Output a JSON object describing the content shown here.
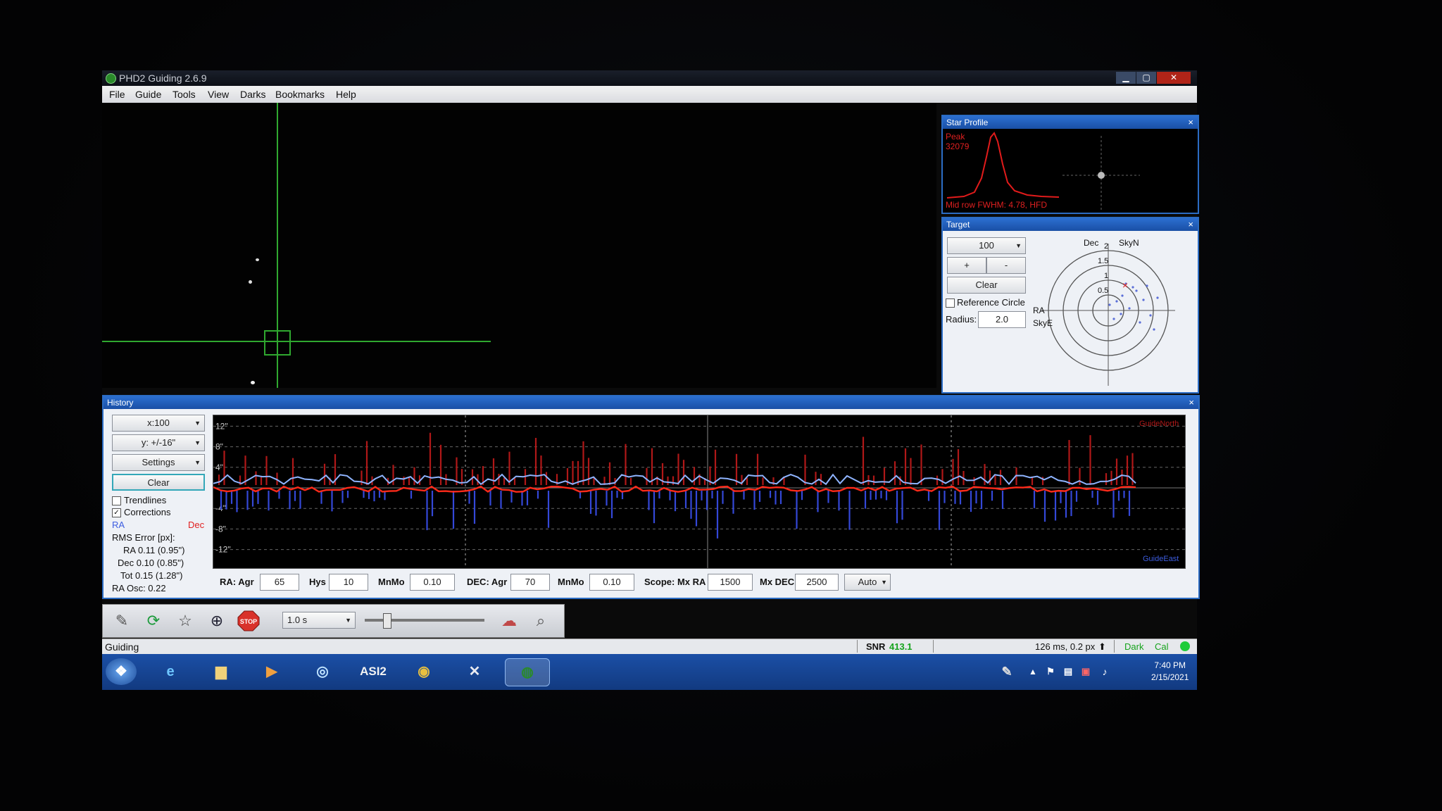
{
  "window": {
    "title": "PHD2 Guiding 2.6.9",
    "min_glyph": "▁",
    "max_glyph": "▢",
    "close_glyph": "✕"
  },
  "menu": [
    "File",
    "Guide",
    "Tools",
    "View",
    "Darks",
    "Bookmarks",
    "Help"
  ],
  "star_profile": {
    "title": "Star Profile",
    "close": "×",
    "peak_label": "Peak",
    "peak_value": "32079",
    "footer": "Mid row FWHM: 4.78, HFD"
  },
  "target": {
    "title": "Target",
    "close": "×",
    "zoom_value": "100",
    "plus": "+",
    "minus": "-",
    "clear": "Clear",
    "reference_circle": "Reference Circle",
    "radius_label": "Radius:",
    "radius_value": "2.0",
    "axis_dec": "Dec",
    "axis_skyn": "SkyN",
    "axis_ra": "RA",
    "axis_skye": "SkyE",
    "rings": [
      "2",
      "1.5",
      "1",
      "0.5"
    ]
  },
  "history": {
    "title": "History",
    "close": "×",
    "x_scale": "x:100",
    "y_scale": "y: +/-16\"",
    "settings": "Settings",
    "clear": "Clear",
    "trendlines_label": "Trendlines",
    "trendlines_checked": false,
    "corrections_label": "Corrections",
    "corrections_checked": true,
    "ra_legend": "RA",
    "dec_legend": "Dec",
    "rms_title": "RMS Error [px]:",
    "rms_ra": "RA 0.11 (0.95\")",
    "rms_dec": "Dec 0.10 (0.85\")",
    "rms_tot": "Tot 0.15 (1.28\")",
    "ra_osc": "RA Osc: 0.22",
    "y_ticks": [
      "12\"",
      "8\"",
      "4\"",
      "-4\"",
      "-8\"",
      "-12\""
    ],
    "guide_north": "GuideNorth",
    "guide_east": "GuideEast",
    "colors": {
      "ra": "#8fb4ff",
      "dec": "#ff2a1a",
      "north_pulse": "#b01818",
      "east_pulse": "#3448d8"
    }
  },
  "params": {
    "ra_agr_label": "RA: Agr",
    "ra_agr": "65",
    "hys_label": "Hys",
    "hys": "10",
    "mnmo1_label": "MnMo",
    "mnmo1": "0.10",
    "dec_agr_label": "DEC: Agr",
    "dec_agr": "70",
    "mnmo2_label": "MnMo",
    "mnmo2": "0.10",
    "scope_label": "Scope: Mx RA",
    "mx_ra": "1500",
    "mx_dec_label": "Mx DEC",
    "mx_dec": "2500",
    "dec_mode": "Auto"
  },
  "toolbar": {
    "exposure": "1.0 s",
    "stop_label": "STOP",
    "gamma_level": 0.18
  },
  "status": {
    "mode": "Guiding",
    "snr_label": "SNR",
    "snr_value": "413.1",
    "timing": "126 ms, 0.2 px",
    "dark": "Dark",
    "cal": "Cal",
    "ok_color": "#1ecc3a"
  },
  "taskbar": {
    "asi_label": "ASI2",
    "time": "7:40 PM",
    "date": "2/15/2021"
  }
}
